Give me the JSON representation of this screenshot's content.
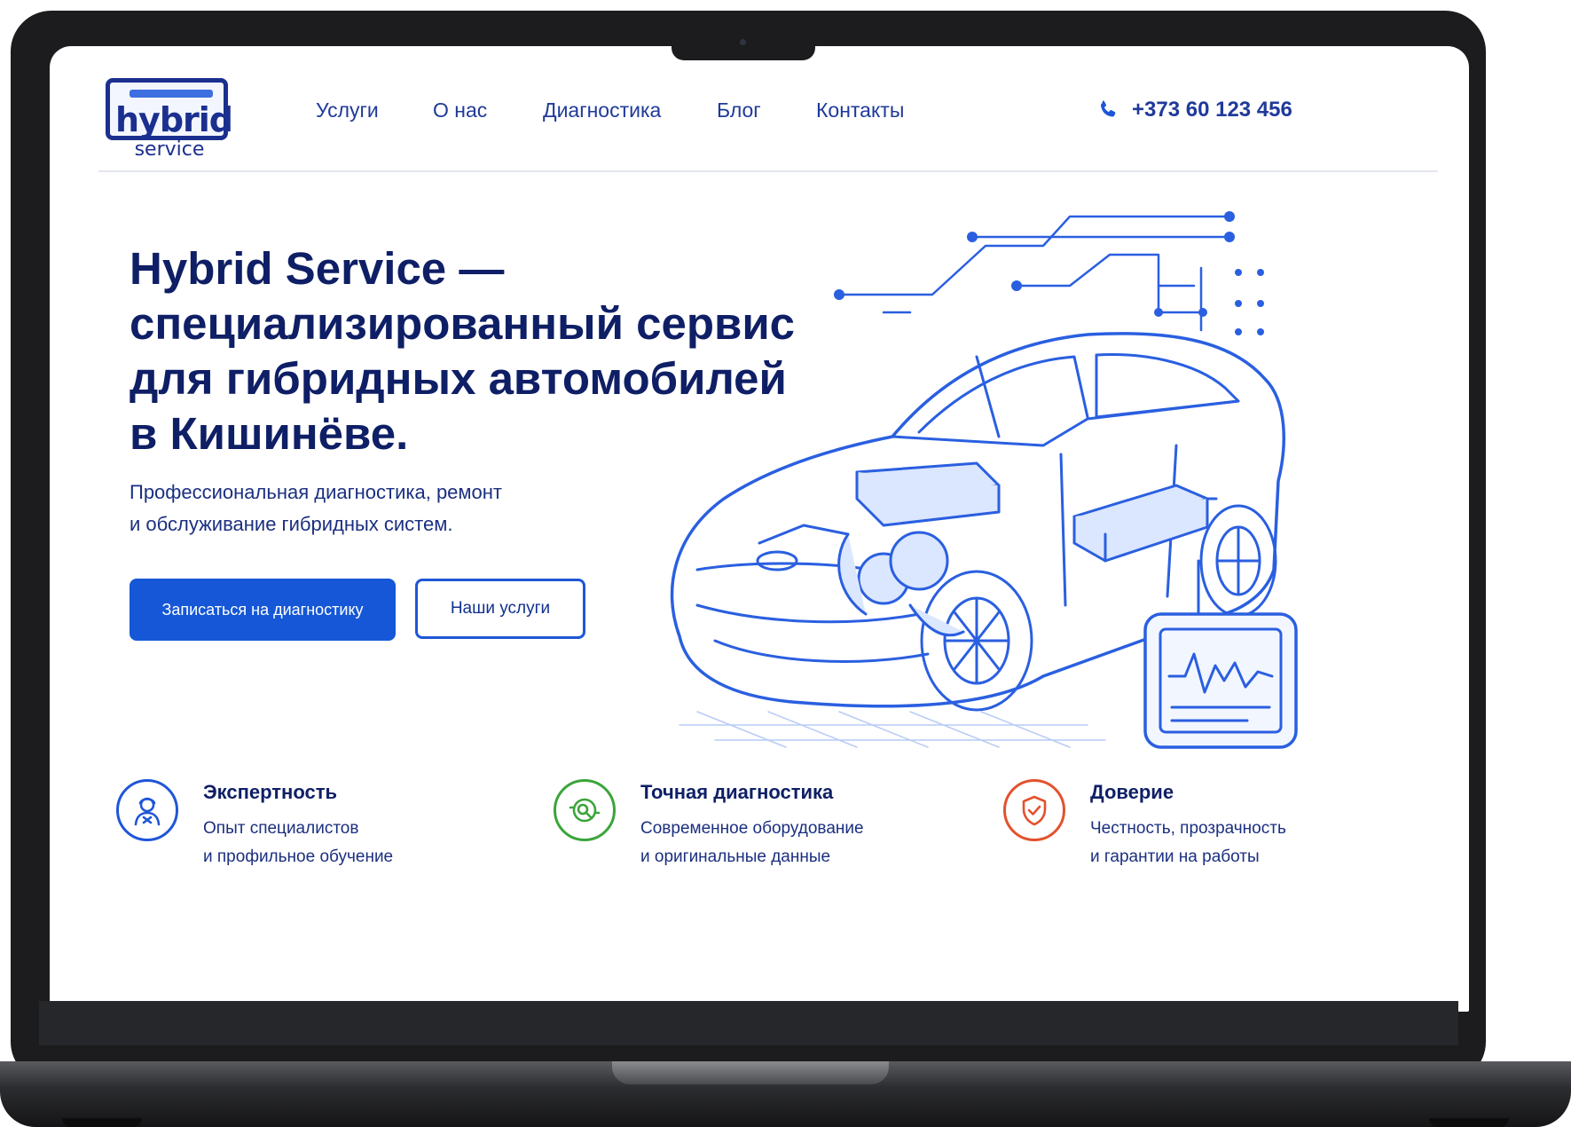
{
  "brand": {
    "logo_word": "hybrid",
    "logo_sub": "service"
  },
  "nav": {
    "items": [
      "Услуги",
      "О нас",
      "Диагностика",
      "Блог",
      "Контакты"
    ]
  },
  "contact": {
    "phone": "+373 60 123 456",
    "icon": "phone-icon"
  },
  "hero": {
    "title_lines": [
      "Hybrid Service —",
      "специализированный сервис",
      "для гибридных автомобилей",
      "в Кишинёве."
    ],
    "subtitle_lines": [
      "Профессиональная диагностика, ремонт",
      "и обслуживание гибридных систем."
    ],
    "primary_button": "Записаться на диагностику",
    "secondary_button": "Наши услуги",
    "illustration": "hybrid-car-blueprint"
  },
  "features": [
    {
      "icon": "mechanic-icon",
      "color": "#1f56d8",
      "title": "Экспертность",
      "text_lines": [
        "Опыт специалистов",
        "и профильное обучение"
      ]
    },
    {
      "icon": "diagnostics-icon",
      "color": "#3aa53a",
      "title": "Точная диагностика",
      "text_lines": [
        "Современное оборудование",
        "и оригинальные данные"
      ]
    },
    {
      "icon": "shield-check-icon",
      "color": "#e2522e",
      "title": "Доверие",
      "text_lines": [
        "Честность, прозрачность",
        "и гарантии на работы"
      ]
    }
  ],
  "colors": {
    "primary": "#1557d6",
    "heading": "#0f1f66",
    "text": "#1b2f80",
    "frame": "#1c1c1e"
  }
}
